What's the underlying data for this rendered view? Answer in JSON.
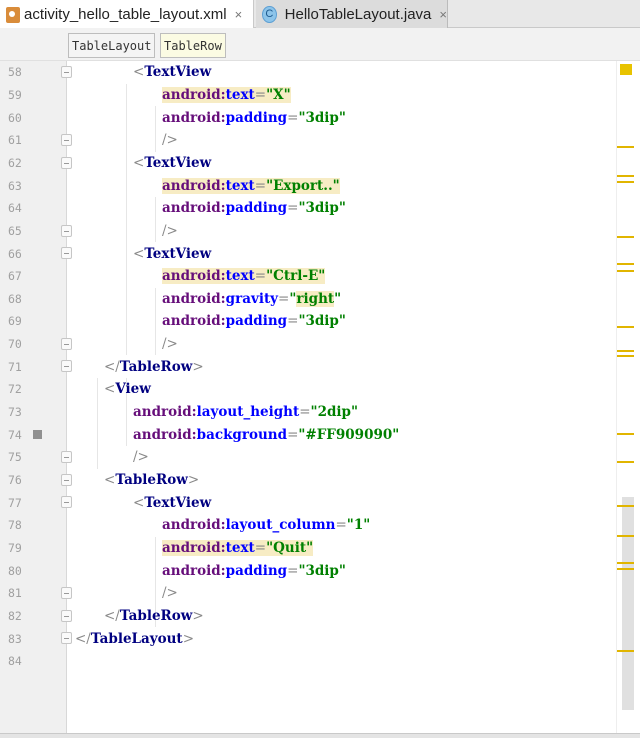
{
  "tabs": [
    {
      "label": "activity_hello_table_layout.xml",
      "icon": "xml-file-icon",
      "active": true
    },
    {
      "label": "HelloTableLayout.java",
      "icon": "java-class-icon",
      "active": false
    }
  ],
  "breadcrumbs": [
    "TableLayout",
    "TableRow"
  ],
  "close_glyph": "×",
  "java_icon_letter": "C",
  "colors": {
    "highlight": "#f7ecc4",
    "marker": "#e1b500",
    "swatch": "#909090"
  },
  "lines": [
    {
      "n": "58",
      "indent": 2,
      "fold": "open",
      "tokens": [
        {
          "t": "punct",
          "s": "<"
        },
        {
          "t": "tag",
          "s": "TextView"
        }
      ]
    },
    {
      "n": "59",
      "indent": 3,
      "tokens": [
        {
          "t": "ns",
          "s": "android:",
          "h": 1
        },
        {
          "t": "attr",
          "s": "text",
          "h": 1
        },
        {
          "t": "punct",
          "s": "=",
          "h": 1
        },
        {
          "t": "val",
          "s": "\"X\"",
          "h": 1
        }
      ]
    },
    {
      "n": "60",
      "indent": 3,
      "tokens": [
        {
          "t": "ns",
          "s": "android:"
        },
        {
          "t": "attr",
          "s": "padding"
        },
        {
          "t": "punct",
          "s": "="
        },
        {
          "t": "val",
          "s": "\"3dip\""
        }
      ]
    },
    {
      "n": "61",
      "indent": 3,
      "fold": "close",
      "tokens": [
        {
          "t": "punct",
          "s": "/>"
        }
      ]
    },
    {
      "n": "62",
      "indent": 2,
      "fold": "open",
      "tokens": [
        {
          "t": "punct",
          "s": "<"
        },
        {
          "t": "tag",
          "s": "TextView"
        }
      ]
    },
    {
      "n": "63",
      "indent": 3,
      "tokens": [
        {
          "t": "ns",
          "s": "android:",
          "h": 1
        },
        {
          "t": "attr",
          "s": "text",
          "h": 1
        },
        {
          "t": "punct",
          "s": "=",
          "h": 1
        },
        {
          "t": "val",
          "s": "\"Export..\"",
          "h": 1
        }
      ]
    },
    {
      "n": "64",
      "indent": 3,
      "tokens": [
        {
          "t": "ns",
          "s": "android:"
        },
        {
          "t": "attr",
          "s": "padding"
        },
        {
          "t": "punct",
          "s": "="
        },
        {
          "t": "val",
          "s": "\"3dip\""
        }
      ]
    },
    {
      "n": "65",
      "indent": 3,
      "fold": "close",
      "tokens": [
        {
          "t": "punct",
          "s": "/>"
        }
      ]
    },
    {
      "n": "66",
      "indent": 2,
      "fold": "open",
      "tokens": [
        {
          "t": "punct",
          "s": "<"
        },
        {
          "t": "tag",
          "s": "TextView"
        }
      ]
    },
    {
      "n": "67",
      "indent": 3,
      "tokens": [
        {
          "t": "ns",
          "s": "android:",
          "h": 1
        },
        {
          "t": "attr",
          "s": "text",
          "h": 1
        },
        {
          "t": "punct",
          "s": "=",
          "h": 1
        },
        {
          "t": "val",
          "s": "\"Ctrl-E\"",
          "h": 1
        }
      ]
    },
    {
      "n": "68",
      "indent": 3,
      "tokens": [
        {
          "t": "ns",
          "s": "android:"
        },
        {
          "t": "attr",
          "s": "gravity"
        },
        {
          "t": "punct",
          "s": "="
        },
        {
          "t": "val",
          "s": "\""
        },
        {
          "t": "val",
          "s": "right",
          "h": 1
        },
        {
          "t": "val",
          "s": "\""
        }
      ]
    },
    {
      "n": "69",
      "indent": 3,
      "tokens": [
        {
          "t": "ns",
          "s": "android:"
        },
        {
          "t": "attr",
          "s": "padding"
        },
        {
          "t": "punct",
          "s": "="
        },
        {
          "t": "val",
          "s": "\"3dip\""
        }
      ]
    },
    {
      "n": "70",
      "indent": 3,
      "fold": "close",
      "tokens": [
        {
          "t": "punct",
          "s": "/>"
        }
      ]
    },
    {
      "n": "71",
      "indent": 1,
      "fold": "close",
      "tokens": [
        {
          "t": "punct",
          "s": "</"
        },
        {
          "t": "tag",
          "s": "TableRow"
        },
        {
          "t": "punct",
          "s": ">"
        }
      ]
    },
    {
      "n": "72",
      "indent": 1,
      "tokens": [
        {
          "t": "punct",
          "s": "<"
        },
        {
          "t": "tag",
          "s": "View"
        }
      ]
    },
    {
      "n": "73",
      "indent": 2,
      "tokens": [
        {
          "t": "ns",
          "s": "android:"
        },
        {
          "t": "attr",
          "s": "layout_height"
        },
        {
          "t": "punct",
          "s": "="
        },
        {
          "t": "val",
          "s": "\"2dip\""
        }
      ]
    },
    {
      "n": "74",
      "indent": 2,
      "swatch": true,
      "tokens": [
        {
          "t": "ns",
          "s": "android:"
        },
        {
          "t": "attr",
          "s": "background"
        },
        {
          "t": "punct",
          "s": "="
        },
        {
          "t": "val",
          "s": "\"#FF909090\""
        }
      ]
    },
    {
      "n": "75",
      "indent": 2,
      "fold": "close",
      "tokens": [
        {
          "t": "punct",
          "s": "/>"
        }
      ]
    },
    {
      "n": "76",
      "indent": 1,
      "fold": "open",
      "tokens": [
        {
          "t": "punct",
          "s": "<"
        },
        {
          "t": "tag",
          "s": "TableRow"
        },
        {
          "t": "punct",
          "s": ">"
        }
      ]
    },
    {
      "n": "77",
      "indent": 2,
      "fold": "open",
      "tokens": [
        {
          "t": "punct",
          "s": "<"
        },
        {
          "t": "tag",
          "s": "TextView"
        }
      ]
    },
    {
      "n": "78",
      "indent": 3,
      "tokens": [
        {
          "t": "ns",
          "s": "android:"
        },
        {
          "t": "attr",
          "s": "layout_column"
        },
        {
          "t": "punct",
          "s": "="
        },
        {
          "t": "val",
          "s": "\"1\""
        }
      ]
    },
    {
      "n": "79",
      "indent": 3,
      "tokens": [
        {
          "t": "ns",
          "s": "android:",
          "h": 1
        },
        {
          "t": "attr",
          "s": "text",
          "h": 1
        },
        {
          "t": "punct",
          "s": "=",
          "h": 1
        },
        {
          "t": "val",
          "s": "\"Quit\"",
          "h": 1
        }
      ]
    },
    {
      "n": "80",
      "indent": 3,
      "tokens": [
        {
          "t": "ns",
          "s": "android:"
        },
        {
          "t": "attr",
          "s": "padding"
        },
        {
          "t": "punct",
          "s": "="
        },
        {
          "t": "val",
          "s": "\"3dip\""
        }
      ]
    },
    {
      "n": "81",
      "indent": 3,
      "fold": "close",
      "tokens": [
        {
          "t": "punct",
          "s": "/>"
        }
      ]
    },
    {
      "n": "82",
      "indent": 1,
      "fold": "close",
      "tokens": [
        {
          "t": "punct",
          "s": "</"
        },
        {
          "t": "tag",
          "s": "TableRow"
        },
        {
          "t": "punct",
          "s": ">"
        }
      ]
    },
    {
      "n": "83",
      "indent": 0,
      "fold": "close",
      "tokens": [
        {
          "t": "punct",
          "s": "</"
        },
        {
          "t": "tag",
          "s": "TableLayout"
        },
        {
          "t": "punct",
          "s": ">"
        }
      ]
    },
    {
      "n": "84",
      "indent": 0,
      "tokens": []
    }
  ]
}
